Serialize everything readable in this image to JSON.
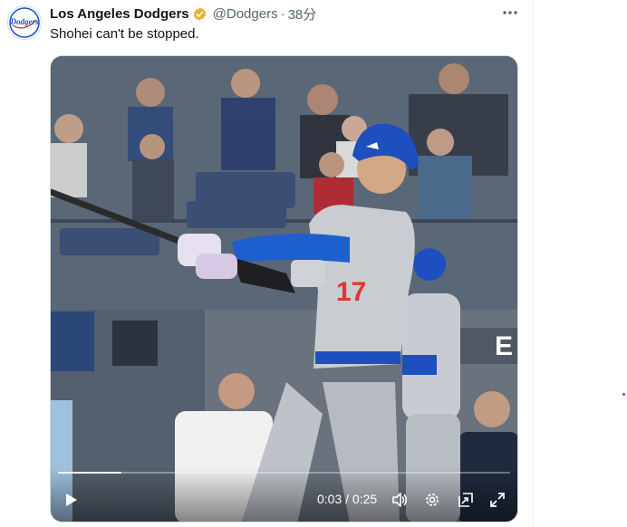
{
  "tweet": {
    "display_name": "Los Angeles Dodgers",
    "handle": "@Dodgers",
    "separator": "·",
    "time": "38分",
    "text": "Shohei can't be stopped.",
    "avatar_text": "Dodgers",
    "more_icon": "more-horizontal-icon",
    "verified_color": "#e8b22d"
  },
  "video": {
    "progress": 0.14,
    "current_time": "0:03",
    "time_separator": "/",
    "duration": "0:25",
    "controls": [
      "play-icon",
      "volume-icon",
      "settings-gear-icon",
      "pop-out-icon",
      "fullscreen-icon"
    ],
    "jersey_number": "17"
  },
  "colors": {
    "text_primary": "#0f1419",
    "text_secondary": "#536471",
    "dodger_blue": "#1e4fbf",
    "border": "#cfd9de"
  }
}
